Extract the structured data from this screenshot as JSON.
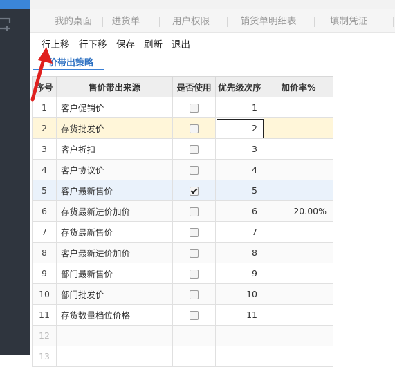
{
  "tabs": [
    "我的桌面",
    "进货单",
    "用户权限",
    "销货单明细表",
    "填制凭证"
  ],
  "toolbar": {
    "move_up": "行上移",
    "move_down": "行下移",
    "save": "保存",
    "refresh": "刷新",
    "exit": "退出"
  },
  "subtab": {
    "label": "价带出策略"
  },
  "grid": {
    "headers": {
      "no": "序号",
      "source": "售价带出来源",
      "use": "是否使用",
      "priority": "优先级次序",
      "rate": "加价率%"
    },
    "rows": [
      {
        "no": "1",
        "source": "客户促销价",
        "checked": false,
        "priority": "1",
        "rate": ""
      },
      {
        "no": "2",
        "source": "存货批发价",
        "checked": false,
        "priority": "2",
        "rate": ""
      },
      {
        "no": "3",
        "source": "客户折扣",
        "checked": false,
        "priority": "3",
        "rate": ""
      },
      {
        "no": "4",
        "source": "客户协议价",
        "checked": false,
        "priority": "4",
        "rate": ""
      },
      {
        "no": "5",
        "source": "客户最新售价",
        "checked": true,
        "priority": "5",
        "rate": ""
      },
      {
        "no": "6",
        "source": "存货最新进价加价",
        "checked": false,
        "priority": "6",
        "rate": "20.00%"
      },
      {
        "no": "7",
        "source": "存货最新售价",
        "checked": false,
        "priority": "7",
        "rate": ""
      },
      {
        "no": "8",
        "source": "客户最新进价加价",
        "checked": false,
        "priority": "8",
        "rate": ""
      },
      {
        "no": "9",
        "source": "部门最新售价",
        "checked": false,
        "priority": "9",
        "rate": ""
      },
      {
        "no": "10",
        "source": "部门批发价",
        "checked": false,
        "priority": "10",
        "rate": ""
      },
      {
        "no": "11",
        "source": "存货数量档位价格",
        "checked": false,
        "priority": "11",
        "rate": ""
      },
      {
        "no": "12",
        "source": "",
        "checked": null,
        "priority": "",
        "rate": ""
      },
      {
        "no": "13",
        "source": "",
        "checked": null,
        "priority": "",
        "rate": ""
      }
    ]
  },
  "colors": {
    "sidebar": "#2f353e",
    "accent": "#3a7fd5",
    "selected_row": "#fff6d9",
    "highlight_row": "#eaf2fb",
    "annotation_arrow": "#e0201e"
  },
  "icons": [
    "add-window-icon",
    "checkbox-icon",
    "red-arrow-annotation"
  ]
}
